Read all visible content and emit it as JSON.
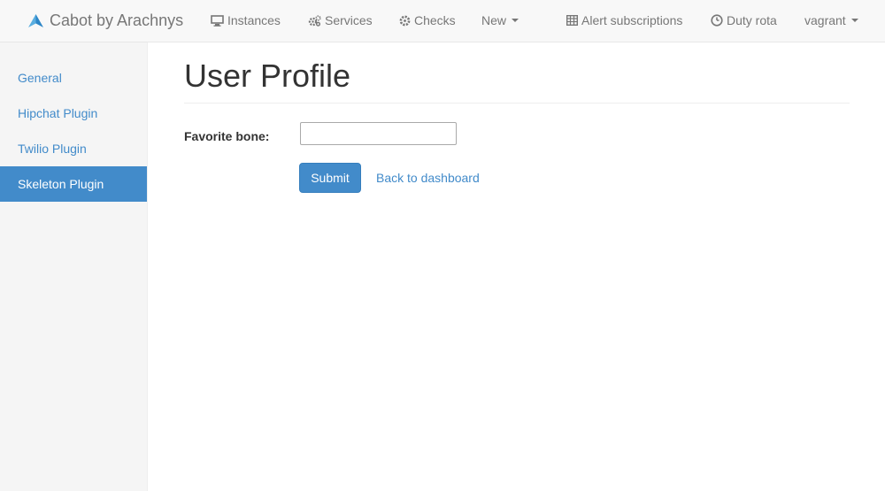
{
  "navbar": {
    "brand": "Cabot by Arachnys",
    "links": {
      "instances": "Instances",
      "services": "Services",
      "checks": "Checks",
      "new": "New",
      "alert_subscriptions": "Alert subscriptions",
      "duty_rota": "Duty rota",
      "user": "vagrant"
    }
  },
  "sidebar": {
    "items": [
      {
        "label": "General"
      },
      {
        "label": "Hipchat Plugin"
      },
      {
        "label": "Twilio Plugin"
      },
      {
        "label": "Skeleton Plugin"
      }
    ]
  },
  "main": {
    "title": "User Profile",
    "form": {
      "favorite_bone_label": "Favorite bone:",
      "favorite_bone_value": "",
      "submit_label": "Submit",
      "back_link": "Back to dashboard"
    }
  },
  "colors": {
    "accent": "#428bca",
    "navbar_bg": "#f8f8f8",
    "sidebar_bg": "#f5f5f5",
    "nav_text": "#777777"
  }
}
